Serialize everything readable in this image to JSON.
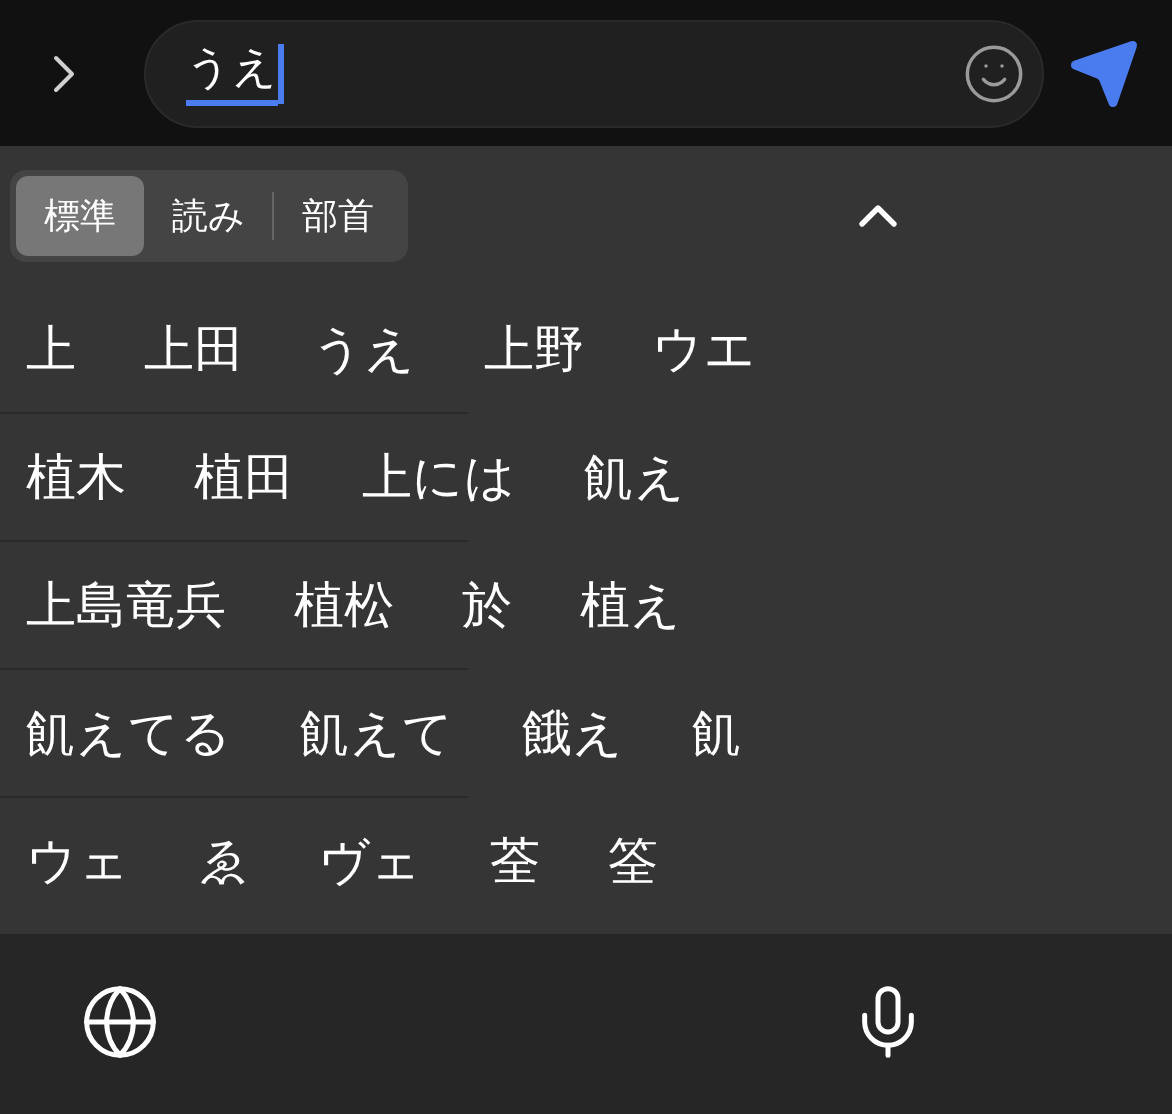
{
  "input": {
    "value": "うえ",
    "composing": true
  },
  "segments": [
    {
      "label": "標準",
      "selected": true
    },
    {
      "label": "読み",
      "selected": false
    },
    {
      "label": "部首",
      "selected": false
    }
  ],
  "candidate_rows": [
    [
      "上",
      "上田",
      "うえ",
      "上野",
      "ウエ"
    ],
    [
      "植木",
      "植田",
      "上には",
      "飢え"
    ],
    [
      "上島竜兵",
      "植松",
      "於",
      "植え"
    ],
    [
      "飢えてる",
      "飢えて",
      "餓え",
      "飢"
    ],
    [
      "ウェ",
      "ゑ",
      "ヴェ",
      "荃",
      "筌"
    ]
  ]
}
